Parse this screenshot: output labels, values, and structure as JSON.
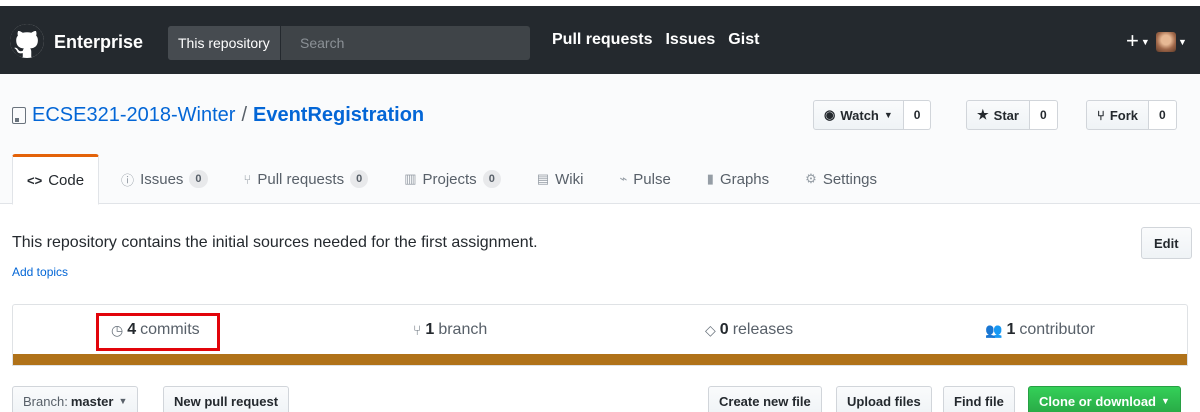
{
  "header": {
    "brand": "Enterprise",
    "search_scope": "This repository",
    "search_placeholder": "Search",
    "nav": [
      "Pull requests",
      "Issues",
      "Gist"
    ],
    "plus_label": "+"
  },
  "repo": {
    "owner": "ECSE321-2018-Winter",
    "separator": "/",
    "name": "EventRegistration",
    "watch_label": "Watch",
    "watch_count": "0",
    "star_label": "Star",
    "star_count": "0",
    "fork_label": "Fork",
    "fork_count": "0"
  },
  "tabs": [
    {
      "label": "Code",
      "icon": "code-icon",
      "glyph": "<>"
    },
    {
      "label": "Issues",
      "icon": "issue-icon",
      "glyph": "ⓘ",
      "count": "0"
    },
    {
      "label": "Pull requests",
      "icon": "pull-request-icon",
      "glyph": "⑂",
      "count": "0"
    },
    {
      "label": "Projects",
      "icon": "project-icon",
      "glyph": "▥",
      "count": "0"
    },
    {
      "label": "Wiki",
      "icon": "wiki-icon",
      "glyph": "▤"
    },
    {
      "label": "Pulse",
      "icon": "pulse-icon",
      "glyph": "⌁"
    },
    {
      "label": "Graphs",
      "icon": "graph-icon",
      "glyph": "▮"
    },
    {
      "label": "Settings",
      "icon": "gear-icon",
      "glyph": "⚙"
    }
  ],
  "description": "This repository contains the initial sources needed for the first assignment.",
  "add_topics": "Add topics",
  "edit_label": "Edit",
  "summary": {
    "commits_count": "4",
    "commits_label": "commits",
    "branch_count": "1",
    "branch_label": "branch",
    "releases_count": "0",
    "releases_label": "releases",
    "contributor_count": "1",
    "contributor_label": "contributor"
  },
  "file_nav": {
    "branch_prefix": "Branch:",
    "branch_name": "master",
    "new_pr": "New pull request",
    "create_file": "Create new file",
    "upload_files": "Upload files",
    "find_file": "Find file",
    "clone": "Clone or download"
  },
  "colors": {
    "header_bg": "#24292e",
    "link": "#0366d6",
    "language_bar": "#b07219",
    "highlight": "#e2040a",
    "clone_green": "#28a745"
  }
}
